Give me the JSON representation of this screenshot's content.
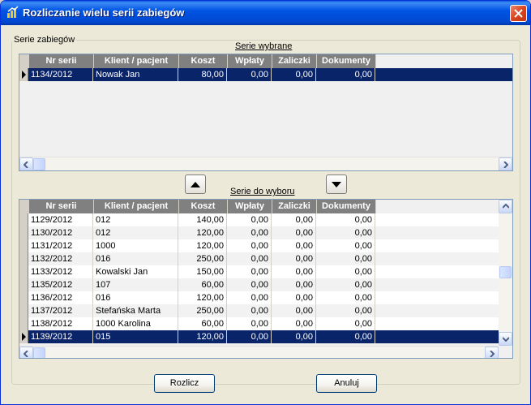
{
  "window": {
    "title": "Rozliczanie wielu serii zabiegów"
  },
  "group": {
    "label": "Serie zabiegów"
  },
  "selected": {
    "caption": "Serie wybrane"
  },
  "available": {
    "caption": "Serie do wyboru"
  },
  "columns": [
    "Nr serii",
    "Klient / pacjent",
    "Koszt",
    "Wpłaty",
    "Zaliczki",
    "Dokumenty"
  ],
  "selected_rows": [
    [
      "1134/2012",
      "Nowak Jan",
      "80,00",
      "0,00",
      "0,00",
      "0,00"
    ]
  ],
  "available_rows": [
    [
      "1129/2012",
      "012",
      "140,00",
      "0,00",
      "0,00",
      "0,00"
    ],
    [
      "1130/2012",
      "012",
      "120,00",
      "0,00",
      "0,00",
      "0,00"
    ],
    [
      "1131/2012",
      "1000",
      "120,00",
      "0,00",
      "0,00",
      "0,00"
    ],
    [
      "1132/2012",
      "016",
      "250,00",
      "0,00",
      "0,00",
      "0,00"
    ],
    [
      "1133/2012",
      "Kowalski Jan",
      "150,00",
      "0,00",
      "0,00",
      "0,00"
    ],
    [
      "1135/2012",
      "107",
      "60,00",
      "0,00",
      "0,00",
      "0,00"
    ],
    [
      "1136/2012",
      "016",
      "120,00",
      "0,00",
      "0,00",
      "0,00"
    ],
    [
      "1137/2012",
      "Stefańska Marta",
      "250,00",
      "0,00",
      "0,00",
      "0,00"
    ],
    [
      "1138/2012",
      "1000 Karolina",
      "60,00",
      "0,00",
      "0,00",
      "0,00"
    ],
    [
      "1139/2012",
      "015",
      "120,00",
      "0,00",
      "0,00",
      "0,00"
    ]
  ],
  "buttons": {
    "settle": "Rozlicz",
    "cancel": "Anuluj"
  },
  "icons": {
    "title": "app-icon",
    "close": "close-icon",
    "move_up": "arrow-up-icon",
    "move_down": "arrow-down-icon"
  },
  "colors": {
    "titlebar": "#0054e3",
    "selection": "#0a246a",
    "header": "#808080"
  }
}
